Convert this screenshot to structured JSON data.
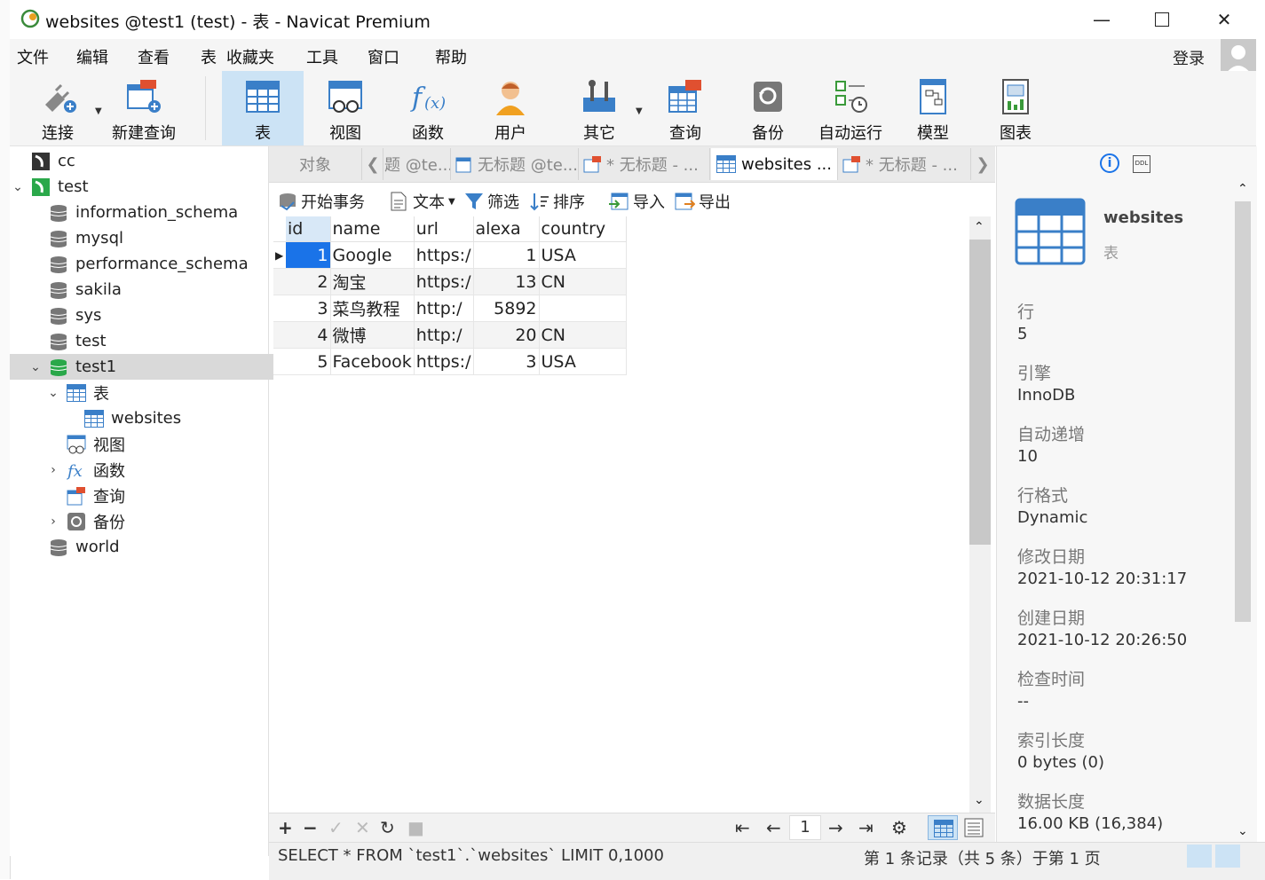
{
  "window": {
    "title": "websites @test1 (test) - 表 - Navicat Premium"
  },
  "menu": [
    "文件",
    "编辑",
    "查看",
    "表",
    "收藏夹",
    "工具",
    "窗口",
    "帮助"
  ],
  "login": "登录",
  "toolbar": {
    "connect": "连接",
    "new_query": "新建查询",
    "table": "表",
    "view": "视图",
    "function": "函数",
    "user": "用户",
    "other": "其它",
    "query": "查询",
    "backup": "备份",
    "auto_run": "自动运行",
    "model": "模型",
    "chart": "图表"
  },
  "tree": {
    "cc": "cc",
    "test": "test",
    "dbs": [
      "information_schema",
      "mysql",
      "performance_schema",
      "sakila",
      "sys",
      "test"
    ],
    "test1": "test1",
    "tables_node": "表",
    "websites": "websites",
    "views": "视图",
    "functions": "函数",
    "queries": "查询",
    "backups": "备份",
    "world": "world"
  },
  "tabs": {
    "objects": "对象",
    "t1": "题 @te...",
    "t2": "无标题 @te...",
    "t3": "* 无标题 - ...",
    "t4": "websites ...",
    "t5": "* 无标题 - ..."
  },
  "grid_tools": {
    "begin_tx": "开始事务",
    "text": "文本",
    "filter": "筛选",
    "sort": "排序",
    "import": "导入",
    "export": "导出"
  },
  "table": {
    "columns": [
      "id",
      "name",
      "url",
      "alexa",
      "country"
    ],
    "rows": [
      [
        "1",
        "Google",
        "https:/",
        "1",
        "USA"
      ],
      [
        "2",
        "淘宝",
        "https:/",
        "13",
        "CN"
      ],
      [
        "3",
        "菜鸟教程",
        "http:/",
        "5892",
        ""
      ],
      [
        "4",
        "微博",
        "http:/",
        "20",
        "CN"
      ],
      [
        "5",
        "Facebook",
        "https:/",
        "3",
        "USA"
      ]
    ]
  },
  "pager": {
    "page": "1"
  },
  "status": {
    "sql": "SELECT * FROM `test1`.`websites` LIMIT 0,1000",
    "records": "第 1 条记录（共 5 条）于第 1 页"
  },
  "info": {
    "name": "websites",
    "type": "表",
    "rows_label": "行",
    "rows": "5",
    "engine_label": "引擎",
    "engine": "InnoDB",
    "auto_inc_label": "自动递增",
    "auto_inc": "10",
    "row_format_label": "行格式",
    "row_format": "Dynamic",
    "modified_label": "修改日期",
    "modified": "2021-10-12 20:31:17",
    "created_label": "创建日期",
    "created": "2021-10-12 20:26:50",
    "checked_label": "检查时间",
    "checked": "--",
    "index_len_label": "索引长度",
    "index_len": "0 bytes (0)",
    "data_len_label": "数据长度",
    "data_len": "16.00 KB (16,384)"
  }
}
